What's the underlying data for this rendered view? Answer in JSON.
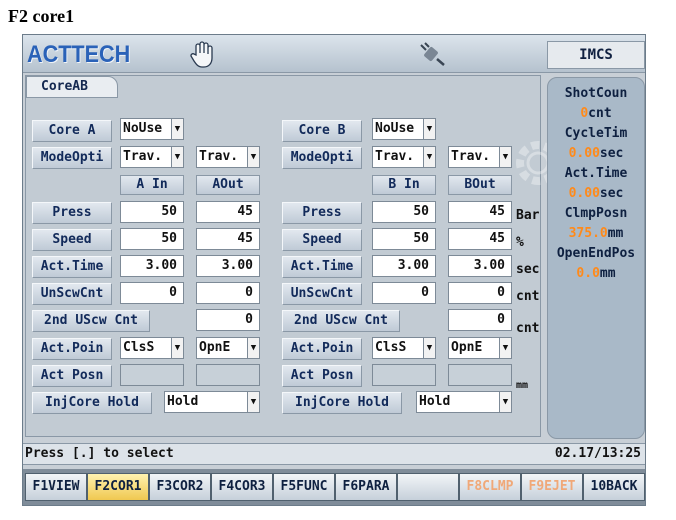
{
  "caption": "F2 core1",
  "header": {
    "brand": "ACTTECH",
    "system": "IMCS",
    "icons": [
      "hand-icon",
      "plug-icon"
    ]
  },
  "tab": "CoreAB",
  "core_a": {
    "core_label": "Core A",
    "core_value": "NoUse",
    "mode_label": "ModeOpti",
    "mode_in": "Trav.",
    "mode_out": "Trav.",
    "col_in": "A In",
    "col_out": "AOut",
    "press_label": "Press",
    "press_in": "50",
    "press_out": "45",
    "speed_label": "Speed",
    "speed_in": "50",
    "speed_out": "45",
    "time_label": "Act.Time",
    "time_in": "3.00",
    "time_out": "3.00",
    "unscw_label": "UnScwCnt",
    "unscw_in": "0",
    "unscw_out": "0",
    "uscw2_label": "2nd UScw Cnt",
    "uscw2_out": "0",
    "actpoin_label": "Act.Poin",
    "actpoin_in": "ClsS",
    "actpoin_out": "OpnE",
    "actposn_label": "Act Posn",
    "hold_label": "InjCore Hold",
    "hold_value": "Hold"
  },
  "core_b": {
    "core_label": "Core B",
    "core_value": "NoUse",
    "mode_label": "ModeOpti",
    "mode_in": "Trav.",
    "mode_out": "Trav.",
    "col_in": "B In",
    "col_out": "BOut",
    "press_label": "Press",
    "press_in": "50",
    "press_out": "45",
    "speed_label": "Speed",
    "speed_in": "50",
    "speed_out": "45",
    "time_label": "Act.Time",
    "time_in": "3.00",
    "time_out": "3.00",
    "unscw_label": "UnScwCnt",
    "unscw_in": "0",
    "unscw_out": "0",
    "uscw2_label": "2nd UScw Cnt",
    "uscw2_out": "0",
    "actpoin_label": "Act.Poin",
    "actpoin_in": "ClsS",
    "actpoin_out": "OpnE",
    "actposn_label": "Act Posn",
    "hold_label": "InjCore Hold",
    "hold_value": "Hold"
  },
  "units": {
    "press": "Bar",
    "speed": "%",
    "time": "sec",
    "unscw": "cnt",
    "uscw2": "cnt",
    "posn": "mm"
  },
  "side": {
    "shot_label": "ShotCoun",
    "shot_value": "0",
    "shot_unit": "cnt",
    "cycle_label": "CycleTim",
    "cycle_value": "0.00",
    "cycle_unit": "sec",
    "act_label": "Act.Time",
    "act_value": "0.00",
    "act_unit": "sec",
    "clmp_label": "ClmpPosn",
    "clmp_value": "375.0",
    "clmp_unit": "mm",
    "open_label": "OpenEndPos",
    "open_value": "0.0",
    "open_unit": "mm"
  },
  "status": {
    "message": "Press [.] to select",
    "datetime": "02.17/13:25"
  },
  "fkeys": [
    "F1VIEW",
    "F2COR1",
    "F3COR2",
    "F4COR3",
    "F5FUNC",
    "F6PARA",
    "",
    "F8CLMP",
    "F9EJET",
    "10BACK"
  ],
  "accent_colors": {
    "value_orange": "#ff8a1a",
    "active_key": "#f0c850",
    "brand_blue": "#2a62b8"
  }
}
